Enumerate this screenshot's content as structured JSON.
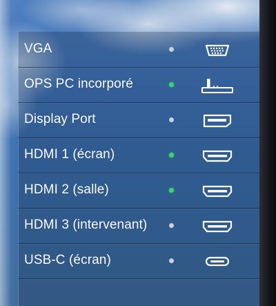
{
  "colors": {
    "active_dot": "#39d66a",
    "inactive_dot": "#c8d2dd",
    "text": "#ffffff"
  },
  "sources": [
    {
      "label": "VGA",
      "active": false,
      "icon": "vga-port-icon"
    },
    {
      "label": "OPS PC incorporé",
      "active": true,
      "icon": "ops-pc-icon"
    },
    {
      "label": "Display Port",
      "active": false,
      "icon": "displayport-icon"
    },
    {
      "label": "HDMI 1 (écran)",
      "active": true,
      "icon": "hdmi-port-icon"
    },
    {
      "label": "HDMI 2 (salle)",
      "active": true,
      "icon": "hdmi-port-icon"
    },
    {
      "label": "HDMI 3 (intervenant)",
      "active": false,
      "icon": "hdmi-port-icon"
    },
    {
      "label": "USB-C (écran)",
      "active": false,
      "icon": "usb-c-port-icon"
    }
  ]
}
